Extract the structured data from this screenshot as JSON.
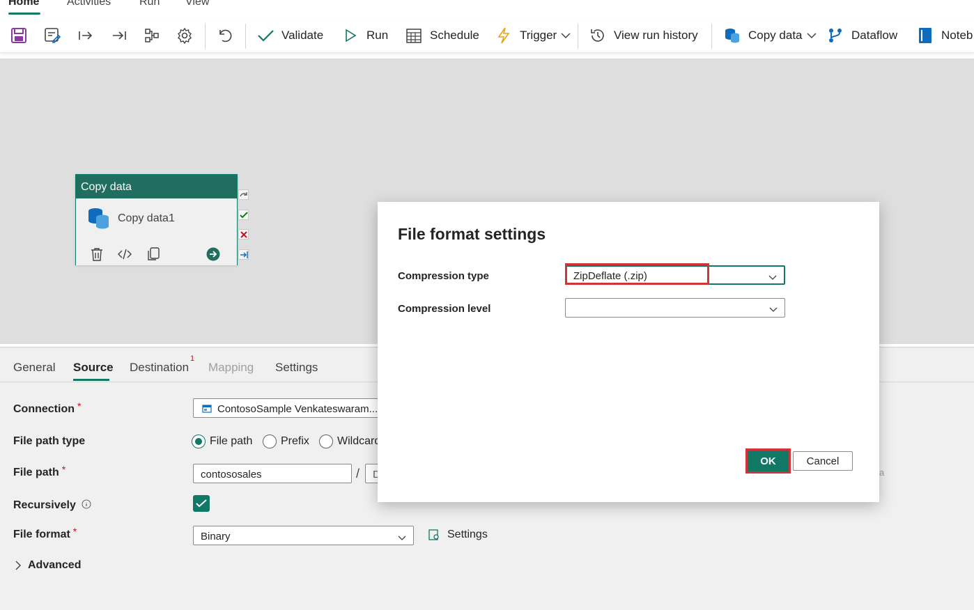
{
  "menu": {
    "tabs": [
      {
        "label": "Home"
      },
      {
        "label": "Activities"
      },
      {
        "label": "Run"
      },
      {
        "label": "View"
      }
    ]
  },
  "toolbar": {
    "validate_label": "Validate",
    "run_label": "Run",
    "schedule_label": "Schedule",
    "trigger_label": "Trigger",
    "view_run_history_label": "View run history",
    "copy_data_label": "Copy data",
    "dataflow_label": "Dataflow",
    "notebook_label": "Noteb"
  },
  "canvas": {
    "activity": {
      "type_label": "Copy data",
      "name": "Copy data1"
    }
  },
  "panel": {
    "tabs": [
      {
        "label": "General"
      },
      {
        "label": "Source"
      },
      {
        "label": "Destination"
      },
      {
        "label": "Mapping"
      },
      {
        "label": "Settings"
      }
    ],
    "destination_badge": "1",
    "fields": {
      "connection_label": "Connection",
      "connection_value": "ContosoSample Venkateswaram...",
      "file_path_type_label": "File path type",
      "radio_file_path": "File path",
      "radio_prefix": "Prefix",
      "radio_wildcard": "Wildcard",
      "file_path_label": "File path",
      "file_path_value": "contososales",
      "file_path_separator": "/",
      "file_path_second_value": "D",
      "recursively_label": "Recursively",
      "file_format_label": "File format",
      "file_format_value": "Binary",
      "settings_link": "Settings",
      "advanced_label": "Advanced",
      "required_mark": "*",
      "partial_text": "a"
    }
  },
  "dialog": {
    "title": "File format settings",
    "compression_type_label": "Compression type",
    "compression_type_value": "ZipDeflate (.zip)",
    "compression_level_label": "Compression level",
    "compression_level_value": "",
    "ok_label": "OK",
    "cancel_label": "Cancel"
  },
  "colors": {
    "accent": "#117865",
    "activity_header": "#1f6e5f",
    "highlight": "#d13438",
    "required": "#c50f1f"
  }
}
